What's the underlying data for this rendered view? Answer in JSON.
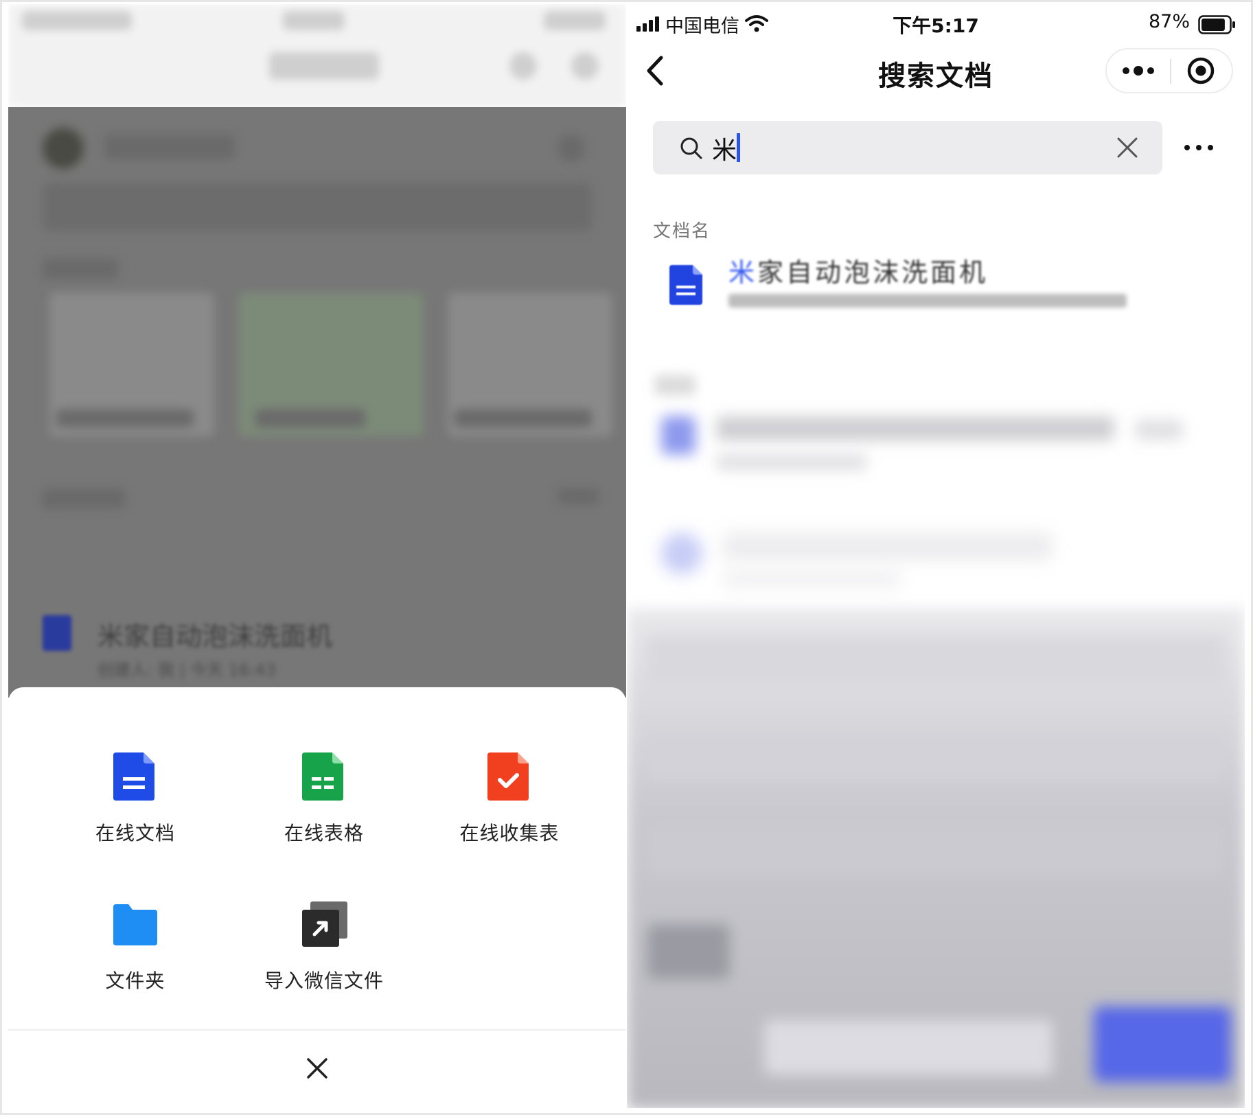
{
  "left_panel": {
    "background_doc": {
      "title": "米家自动泡沫洗面机",
      "meta": "创建人: 我 | 今天 16:43"
    },
    "create_sheet": {
      "items": [
        {
          "label": "在线文档",
          "icon": "online-doc-icon",
          "color": "#1f4ce6"
        },
        {
          "label": "在线表格",
          "icon": "online-sheet-icon",
          "color": "#17a34a"
        },
        {
          "label": "在线收集表",
          "icon": "online-form-icon",
          "color": "#f0401f"
        },
        {
          "label": "文件夹",
          "icon": "folder-icon",
          "color": "#1e8ef5"
        },
        {
          "label": "导入微信文件",
          "icon": "import-wechat-file-icon",
          "color": "#2b2b2b"
        }
      ],
      "close_icon": "close-icon"
    }
  },
  "right_panel": {
    "status_bar": {
      "carrier": "中国电信",
      "time": "下午5:17",
      "battery": "87%",
      "battery_level": 0.87
    },
    "nav": {
      "title": "搜索文档",
      "back_icon": "back-chevron-icon",
      "more_icon": "more-dots-icon",
      "target_icon": "target-icon"
    },
    "search": {
      "value": "米",
      "search_icon": "search-icon",
      "clear_icon": "clear-icon",
      "more_icon": "more-horizontal-icon"
    },
    "section_label": "文档名",
    "results": [
      {
        "title_highlight": "米",
        "title_rest": "家自动泡沫洗面机"
      }
    ]
  }
}
